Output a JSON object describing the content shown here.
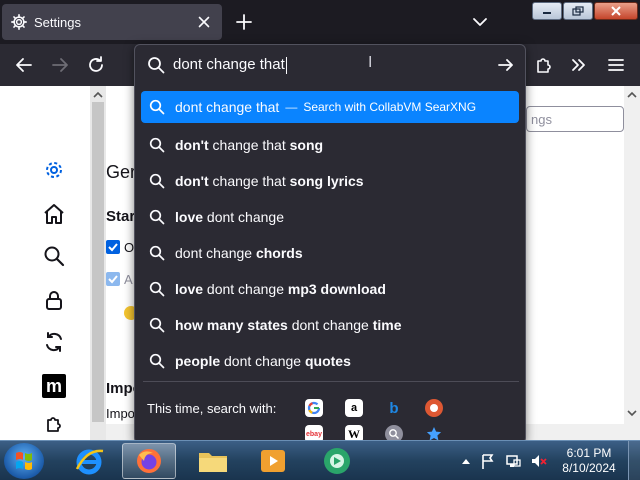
{
  "tab": {
    "title": "Settings"
  },
  "urlbar": {
    "value": "dont change that"
  },
  "suggestions": {
    "selected": {
      "text": "dont change that",
      "sep": "—",
      "action": "Search with CollabVM SearXNG"
    },
    "items": [
      {
        "bold1": "don't",
        "plain": " change that ",
        "bold2": "song"
      },
      {
        "bold1": "don't",
        "plain": " change that ",
        "bold2": "song lyrics"
      },
      {
        "bold1": "love",
        "plain": " dont change",
        "bold2": ""
      },
      {
        "bold1": "",
        "plain": "dont change ",
        "bold2": "chords"
      },
      {
        "bold1": "love",
        "plain": " dont change ",
        "bold2": "mp3 download"
      },
      {
        "bold1": "how many states",
        "plain": " dont change ",
        "bold2": "time"
      },
      {
        "bold1": "people",
        "plain": " dont change ",
        "bold2": "quotes"
      }
    ]
  },
  "oneoff": {
    "label": "This time, search with:",
    "engines": [
      "google-icon",
      "amazon-icon",
      "bing-icon",
      "duckduckgo-icon",
      "ebay-icon",
      "wikipedia-icon",
      "search-engine-icon",
      "bookmarks-star-icon"
    ],
    "ebay_text": "ebay",
    "wiki_text": "W"
  },
  "page": {
    "heading_partial": "Ger",
    "start_partial": "Star",
    "find_placeholder": "ngs",
    "cb1_partial": "O",
    "cb2_partial": "A",
    "imp_heading": "Impo",
    "imp_text": "Impo"
  },
  "clock": {
    "time": "6:01 PM",
    "date": "8/10/2024"
  },
  "colors": {
    "accent": "#0a84ff",
    "panel": "#2b2a33",
    "tabbar": "#1c1b22"
  }
}
